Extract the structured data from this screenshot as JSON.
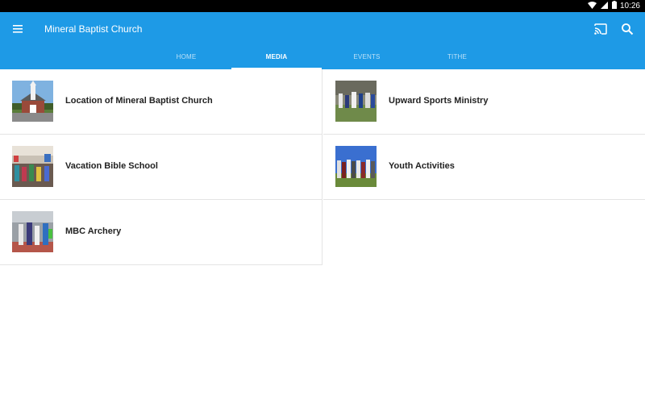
{
  "status": {
    "time": "10:26"
  },
  "app": {
    "title": "Mineral Baptist Church",
    "accent": "#1e9ae6"
  },
  "tabs": [
    {
      "label": "HOME"
    },
    {
      "label": "MEDIA",
      "active": true
    },
    {
      "label": "EVENTS"
    },
    {
      "label": "TITHE"
    }
  ],
  "items": [
    {
      "label": "Location of Mineral Baptist Church",
      "thumb": "church-photo"
    },
    {
      "label": "Upward Sports Ministry",
      "thumb": "sports-photo"
    },
    {
      "label": "Vacation Bible School",
      "thumb": "vbs-photo"
    },
    {
      "label": "Youth Activities",
      "thumb": "youth-photo"
    },
    {
      "label": "MBC Archery",
      "thumb": "archery-photo"
    }
  ]
}
